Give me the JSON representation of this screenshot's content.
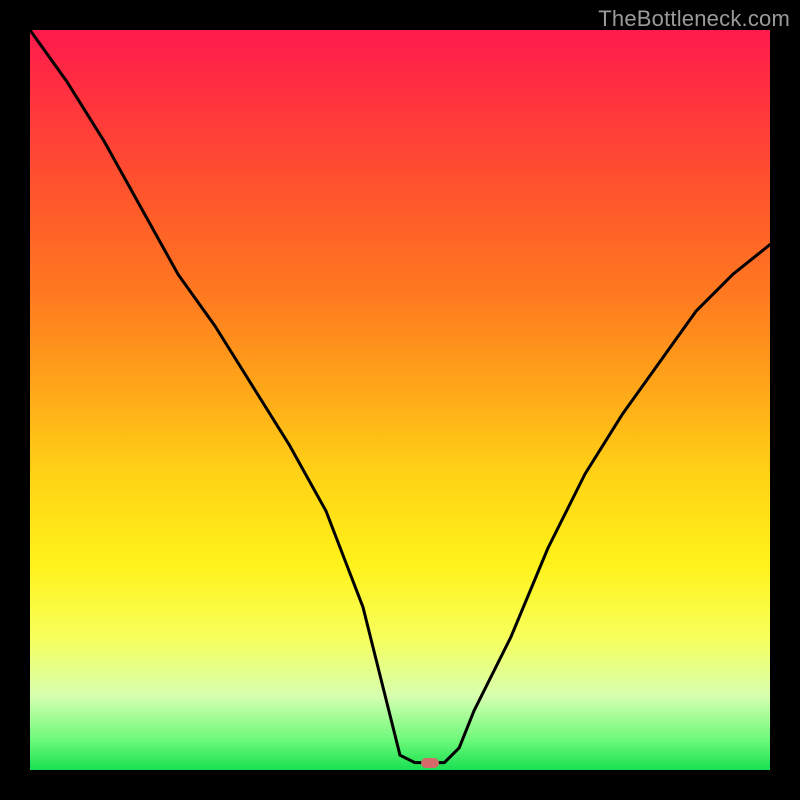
{
  "watermark": "TheBottleneck.com",
  "colors": {
    "frame": "#000000",
    "curve": "#000000",
    "marker": "#d46a6a"
  },
  "chart_data": {
    "type": "line",
    "title": "",
    "xlabel": "",
    "ylabel": "",
    "xlim": [
      0,
      100
    ],
    "ylim": [
      0,
      100
    ],
    "gradient_stops": [
      {
        "pos": 0,
        "color": "#ff1a4d"
      },
      {
        "pos": 12,
        "color": "#ff3a3a"
      },
      {
        "pos": 24,
        "color": "#ff5a2a"
      },
      {
        "pos": 36,
        "color": "#ff7a20"
      },
      {
        "pos": 48,
        "color": "#ffa518"
      },
      {
        "pos": 60,
        "color": "#ffd215"
      },
      {
        "pos": 72,
        "color": "#fff21a"
      },
      {
        "pos": 82,
        "color": "#f7ff5a"
      },
      {
        "pos": 90,
        "color": "#d7ffb0"
      },
      {
        "pos": 96,
        "color": "#6cf97a"
      },
      {
        "pos": 100,
        "color": "#18e050"
      }
    ],
    "series": [
      {
        "name": "bottleneck-curve",
        "x": [
          0,
          5,
          10,
          15,
          20,
          25,
          30,
          35,
          40,
          45,
          48,
          50,
          52,
          54,
          56,
          58,
          60,
          65,
          70,
          75,
          80,
          85,
          90,
          95,
          100
        ],
        "y": [
          100,
          93,
          85,
          76,
          67,
          60,
          52,
          44,
          35,
          22,
          10,
          2,
          1,
          1,
          1,
          3,
          8,
          18,
          30,
          40,
          48,
          55,
          62,
          67,
          71
        ]
      }
    ],
    "marker": {
      "x": 54,
      "y": 1
    }
  }
}
